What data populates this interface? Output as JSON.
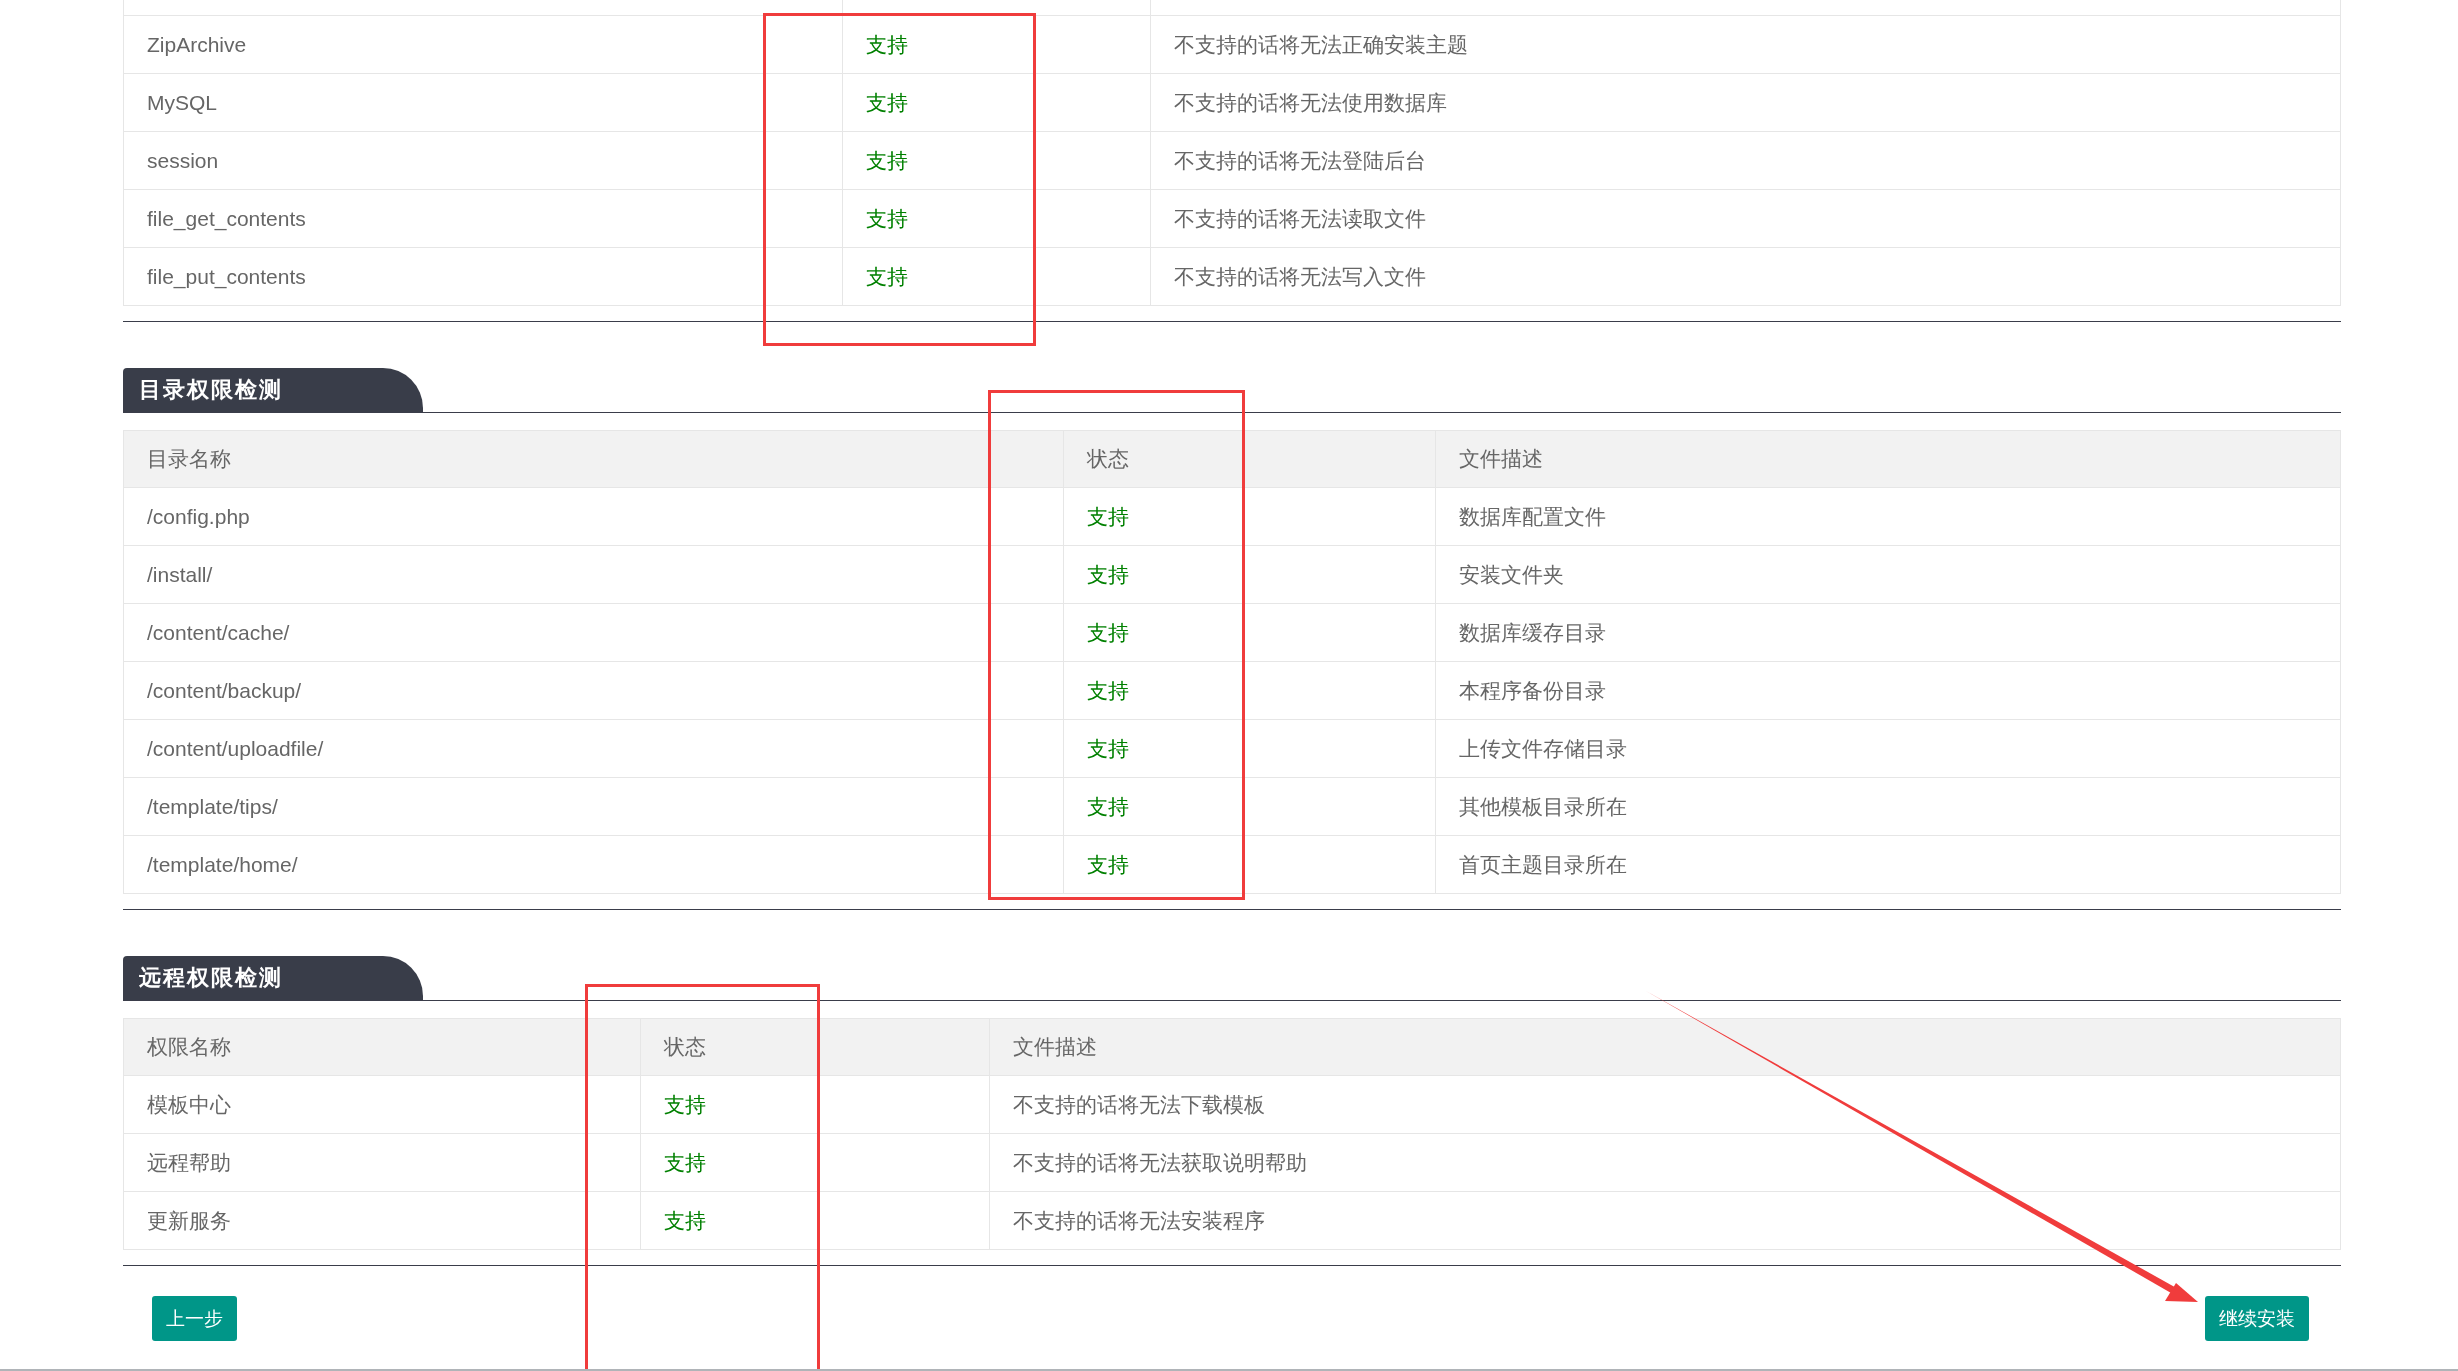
{
  "sections": [
    {
      "rows": [
        {
          "name": "ZipArchive",
          "status": "支持",
          "description": "不支持的话将无法正确安装主题"
        },
        {
          "name": "MySQL",
          "status": "支持",
          "description": "不支持的话将无法使用数据库"
        },
        {
          "name": "session",
          "status": "支持",
          "description": "不支持的话将无法登陆后台"
        },
        {
          "name": "file_get_contents",
          "status": "支持",
          "description": "不支持的话将无法读取文件"
        },
        {
          "name": "file_put_contents",
          "status": "支持",
          "description": "不支持的话将无法写入文件"
        }
      ]
    },
    {
      "title": "目录权限检测",
      "columns": [
        "目录名称",
        "状态",
        "文件描述"
      ],
      "rows": [
        {
          "name": "/config.php",
          "status": "支持",
          "description": "数据库配置文件"
        },
        {
          "name": "/install/",
          "status": "支持",
          "description": "安装文件夹"
        },
        {
          "name": "/content/cache/",
          "status": "支持",
          "description": "数据库缓存目录"
        },
        {
          "name": "/content/backup/",
          "status": "支持",
          "description": "本程序备份目录"
        },
        {
          "name": "/content/uploadfile/",
          "status": "支持",
          "description": "上传文件存储目录"
        },
        {
          "name": "/template/tips/",
          "status": "支持",
          "description": "其他模板目录所在"
        },
        {
          "name": "/template/home/",
          "status": "支持",
          "description": "首页主题目录所在"
        }
      ]
    },
    {
      "title": "远程权限检测",
      "columns": [
        "权限名称",
        "状态",
        "文件描述"
      ],
      "rows": [
        {
          "name": "模板中心",
          "status": "支持",
          "description": "不支持的话将无法下载模板"
        },
        {
          "name": "远程帮助",
          "status": "支持",
          "description": "不支持的话将无法获取说明帮助"
        },
        {
          "name": "更新服务",
          "status": "支持",
          "description": "不支持的话将无法安装程序"
        }
      ]
    }
  ],
  "buttons": [
    {
      "label": "上一步"
    },
    {
      "label": "继续安装"
    }
  ]
}
